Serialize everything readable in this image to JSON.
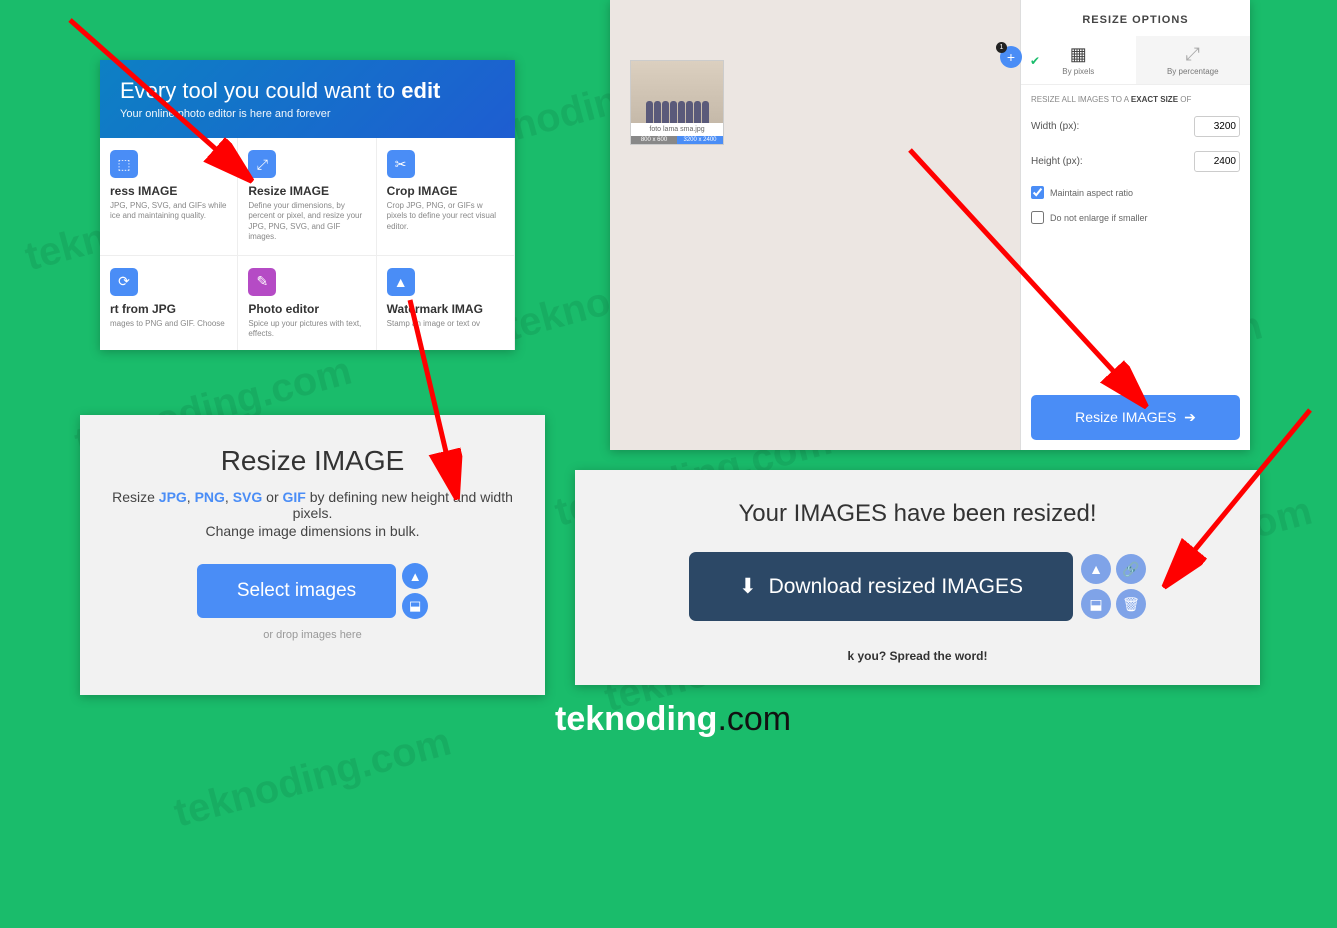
{
  "panel1": {
    "hero_title_pre": "Every tool you could want to ",
    "hero_title_bold": "edit",
    "hero_sub": "Your online photo editor is here and forever",
    "cells": [
      {
        "title": "ress IMAGE",
        "desc": "JPG, PNG, SVG, and GIFs while ice and maintaining quality."
      },
      {
        "title": "Resize IMAGE",
        "desc": "Define your dimensions, by percent or pixel, and resize your JPG, PNG, SVG, and GIF images."
      },
      {
        "title": "Crop IMAGE",
        "desc": "Crop JPG, PNG, or GIFs w pixels to define your rect visual editor."
      },
      {
        "title": "rt from JPG",
        "desc": "mages to PNG and GIF. Choose"
      },
      {
        "title": "Photo editor",
        "desc": "Spice up your pictures with text, effects."
      },
      {
        "title": "Watermark IMAG",
        "desc": "Stamp an image or text ov"
      }
    ]
  },
  "panel2": {
    "title": "Resize IMAGE",
    "line1_pre": "Resize ",
    "fmt1": "JPG",
    "fmt2": "PNG",
    "fmt3": "SVG",
    "fmt4": "GIF",
    "line1_post": " by defining new height and width pixels.",
    "line2": "Change image dimensions in bulk.",
    "select_btn": "Select images",
    "drop": "or drop images here"
  },
  "panel3": {
    "thumb_caption": "foto lama sma.jpg",
    "thumb_dim_old": "800 x 600",
    "thumb_dim_new": "3200 x 2400",
    "add_count": "1",
    "sidebar_title": "RESIZE OPTIONS",
    "tab1": "By pixels",
    "tab2": "By percentage",
    "note_pre": "RESIZE ALL IMAGES TO A ",
    "note_bold": "EXACT SIZE",
    "note_post": " OF",
    "width_label": "Width (px):",
    "width_val": "3200",
    "height_label": "Height (px):",
    "height_val": "2400",
    "chk1": "Maintain aspect ratio",
    "chk2": "Do not enlarge if smaller",
    "resize_btn": "Resize IMAGES"
  },
  "panel4": {
    "title": "Your IMAGES have been resized!",
    "dl_btn": "Download resized IMAGES",
    "footer": "k you? Spread the word!"
  },
  "brand_bold": "teknoding",
  "brand_rest": ".com",
  "watermark": "teknoding.com"
}
